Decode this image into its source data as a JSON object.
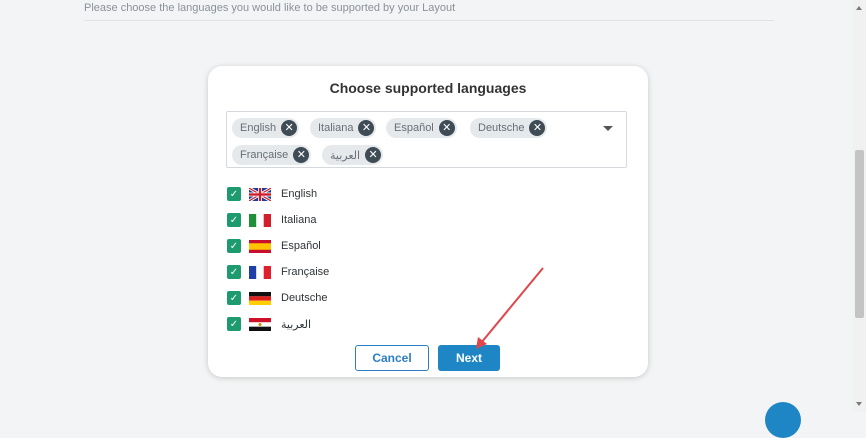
{
  "header": {
    "instruction": "Please choose the languages you would like to be supported by your Layout"
  },
  "modal": {
    "title": "Choose supported languages",
    "selected_tags": [
      "English",
      "Italiana",
      "Español",
      "Deutsche",
      "Française",
      "العربية"
    ],
    "languages": [
      {
        "label": "English",
        "checked": true,
        "flag": "flag-uk-icon"
      },
      {
        "label": "Italiana",
        "checked": true,
        "flag": "flag-italy-icon"
      },
      {
        "label": "Español",
        "checked": true,
        "flag": "flag-spain-icon"
      },
      {
        "label": "Française",
        "checked": true,
        "flag": "flag-france-icon"
      },
      {
        "label": "Deutsche",
        "checked": true,
        "flag": "flag-germany-icon"
      },
      {
        "label": "العربية",
        "checked": true,
        "flag": "flag-egypt-icon"
      }
    ],
    "cancel_label": "Cancel",
    "next_label": "Next"
  },
  "colors": {
    "accent": "#1f86c6",
    "checkbox": "#1e9b6e",
    "annotation_arrow": "#e0464a"
  }
}
